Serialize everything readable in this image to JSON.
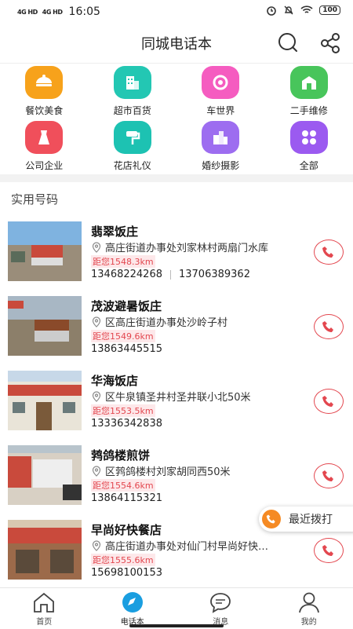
{
  "status_bar": {
    "signal1": "4G HD",
    "signal2": "4G HD",
    "time": "16:05",
    "battery": "100"
  },
  "header": {
    "title": "同城电话本",
    "search_icon": "search-icon",
    "share_icon": "share-icon"
  },
  "categories": [
    {
      "label": "餐饮美食",
      "color": "#f7a21b",
      "icon": "food-icon"
    },
    {
      "label": "超市百货",
      "color": "#23c7b3",
      "icon": "building-icon"
    },
    {
      "label": "车世界",
      "color": "#f55cc0",
      "icon": "car-icon"
    },
    {
      "label": "二手维修",
      "color": "#48c55b",
      "icon": "repair-icon"
    },
    {
      "label": "公司企业",
      "color": "#f04f5b",
      "icon": "company-icon"
    },
    {
      "label": "花店礼仪",
      "color": "#1dc2b2",
      "icon": "flower-icon"
    },
    {
      "label": "婚纱摄影",
      "color": "#9d6df0",
      "icon": "wedding-icon"
    },
    {
      "label": "全部",
      "color": "#9b5af0",
      "icon": "all-icon"
    }
  ],
  "section_title": "实用号码",
  "listings": [
    {
      "name": "翡翠饭庄",
      "address": "高庄街道办事处刘家林村两扇门水库",
      "distance": "距您1548.3km",
      "phones": [
        "13468224268",
        "13706389362"
      ]
    },
    {
      "name": "茂波避暑饭庄",
      "address": "区高庄街道办事处沙岭子村",
      "distance": "距您1549.6km",
      "phones": [
        "13863445515"
      ]
    },
    {
      "name": "华海饭店",
      "address": "区牛泉镇圣井村圣井联小北50米",
      "distance": "距您1553.5km",
      "phones": [
        "13336342838"
      ]
    },
    {
      "name": "鹁鸽楼煎饼",
      "address": "区鹁鸽楼村刘家胡同西50米",
      "distance": "距您1554.6km",
      "phones": [
        "13864115321"
      ]
    },
    {
      "name": "早尚好快餐店",
      "address": "高庄街道办事处对仙门村早尚好快…",
      "distance": "距您1555.6km",
      "phones": [
        "15698100153"
      ]
    }
  ],
  "recent_calls_label": "最近拨打",
  "tabs": [
    {
      "label": "首页",
      "icon": "home-icon"
    },
    {
      "label": "电话本",
      "icon": "compass-icon"
    },
    {
      "label": "消息",
      "icon": "message-icon"
    },
    {
      "label": "我的",
      "icon": "profile-icon"
    }
  ],
  "colors": {
    "accent": "#1a9ee0",
    "call_red": "#e3474f",
    "recent_orange": "#f58a24"
  }
}
